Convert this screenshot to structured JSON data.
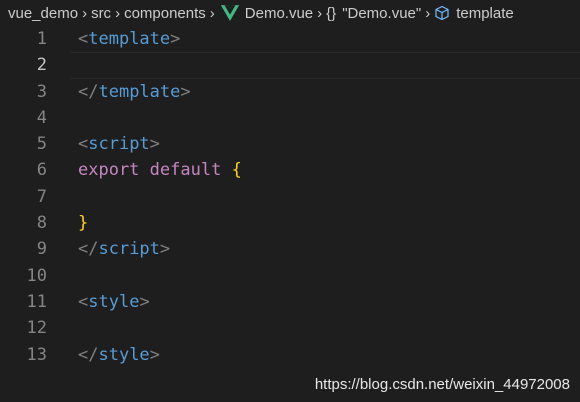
{
  "breadcrumb": {
    "items": [
      "vue_demo",
      "src",
      "components",
      "Demo.vue",
      "\"Demo.vue\"",
      "template"
    ],
    "braces_glyph": "{}"
  },
  "editor": {
    "current_line": 2,
    "lines": [
      {
        "num": "1",
        "tokens": [
          {
            "t": "<",
            "c": "tag-bracket"
          },
          {
            "t": "template",
            "c": "tag-name"
          },
          {
            "t": ">",
            "c": "tag-bracket"
          }
        ]
      },
      {
        "num": "2",
        "tokens": []
      },
      {
        "num": "3",
        "tokens": [
          {
            "t": "</",
            "c": "tag-bracket"
          },
          {
            "t": "template",
            "c": "tag-name"
          },
          {
            "t": ">",
            "c": "tag-bracket"
          }
        ]
      },
      {
        "num": "4",
        "tokens": []
      },
      {
        "num": "5",
        "tokens": [
          {
            "t": "<",
            "c": "tag-bracket"
          },
          {
            "t": "script",
            "c": "tag-name"
          },
          {
            "t": ">",
            "c": "tag-bracket"
          }
        ]
      },
      {
        "num": "6",
        "tokens": [
          {
            "t": "export",
            "c": "keyword"
          },
          {
            "t": " ",
            "c": ""
          },
          {
            "t": "default",
            "c": "keyword"
          },
          {
            "t": " ",
            "c": ""
          },
          {
            "t": "{",
            "c": "brace"
          }
        ]
      },
      {
        "num": "7",
        "tokens": []
      },
      {
        "num": "8",
        "tokens": [
          {
            "t": "}",
            "c": "brace"
          }
        ]
      },
      {
        "num": "9",
        "tokens": [
          {
            "t": "</",
            "c": "tag-bracket"
          },
          {
            "t": "script",
            "c": "tag-name"
          },
          {
            "t": ">",
            "c": "tag-bracket"
          }
        ]
      },
      {
        "num": "10",
        "tokens": []
      },
      {
        "num": "11",
        "tokens": [
          {
            "t": "<",
            "c": "tag-bracket"
          },
          {
            "t": "style",
            "c": "tag-name"
          },
          {
            "t": ">",
            "c": "tag-bracket"
          }
        ]
      },
      {
        "num": "12",
        "tokens": []
      },
      {
        "num": "13",
        "tokens": [
          {
            "t": "</",
            "c": "tag-bracket"
          },
          {
            "t": "style",
            "c": "tag-name"
          },
          {
            "t": ">",
            "c": "tag-bracket"
          }
        ]
      }
    ]
  },
  "watermark": "https://blog.csdn.net/weixin_44972008",
  "colors": {
    "background": "#1e1e1e",
    "tag_name": "#569cd6",
    "keyword": "#c586c0",
    "brace": "#ffd700",
    "line_number": "#858585",
    "vue_green": "#41b883"
  },
  "icons": [
    "chevron-right-icon",
    "vue-file-icon",
    "braces-icon",
    "cube-icon"
  ]
}
